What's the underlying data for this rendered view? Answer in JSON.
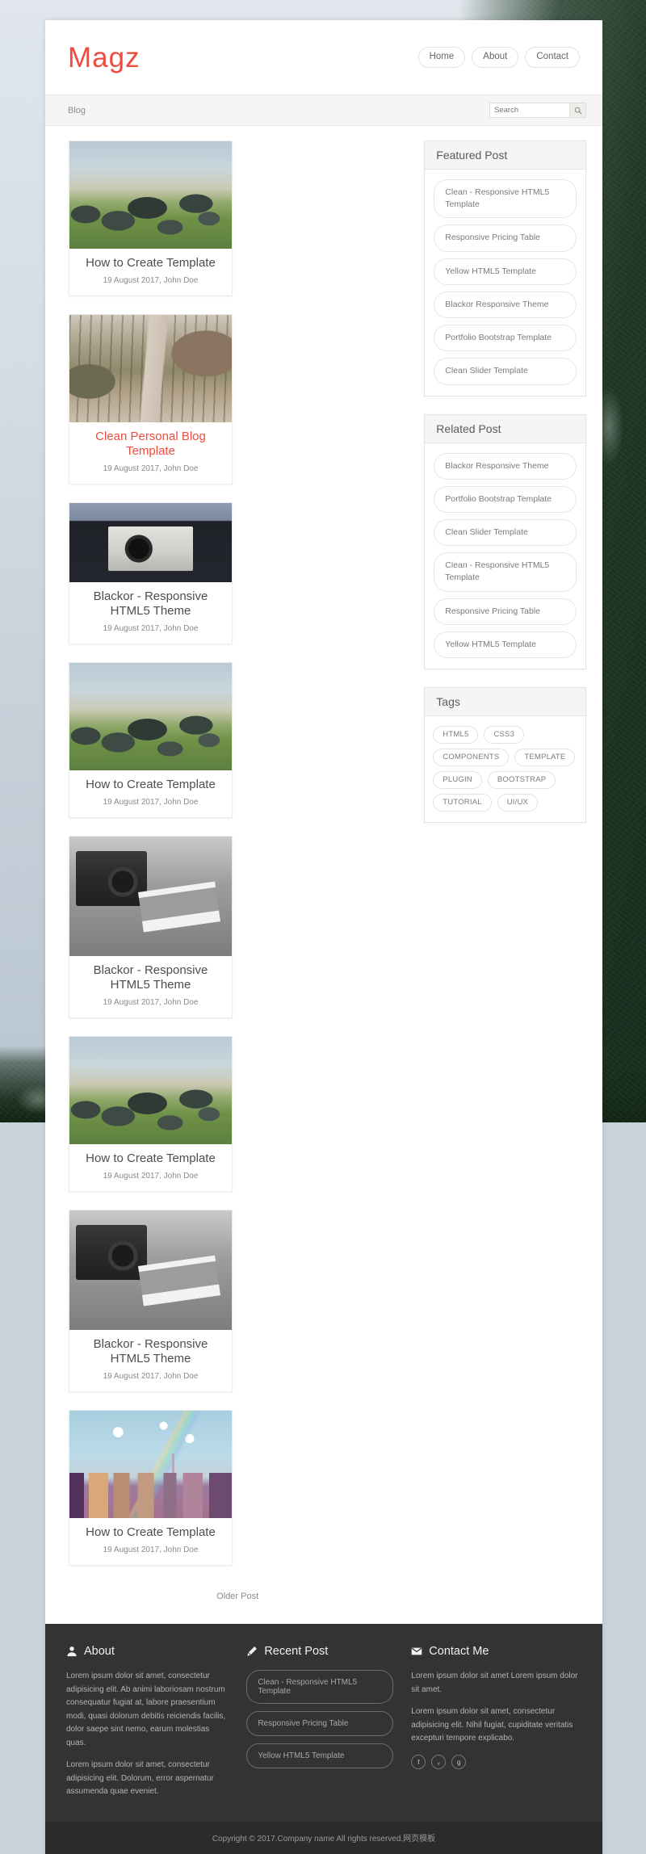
{
  "header": {
    "brand": "Magz",
    "nav": [
      {
        "label": "Home"
      },
      {
        "label": "About"
      },
      {
        "label": "Contact"
      }
    ]
  },
  "subbar": {
    "breadcrumb": "Blog",
    "search_placeholder": "Search",
    "search_value": "",
    "search_icon": "search-icon"
  },
  "posts": [
    {
      "title": "How to Create Template",
      "meta": "19 August 2017, John Doe",
      "thumb": "rocks-field-photo",
      "active": false
    },
    {
      "title": "Clean Personal Blog Template",
      "meta": "19 August 2017, John Doe",
      "thumb": "forest-road-photo",
      "active": true
    },
    {
      "title": "Blackor - Responsive HTML5 Theme",
      "meta": "19 August 2017, John Doe",
      "thumb": "vintage-camera-photo",
      "active": false
    },
    {
      "title": "How to Create Template",
      "meta": "19 August 2017, John Doe",
      "thumb": "rocks-field-photo",
      "active": false
    },
    {
      "title": "Blackor - Responsive HTML5 Theme",
      "meta": "19 August 2017, John Doe",
      "thumb": "bw-slr-camera-photo",
      "active": false
    },
    {
      "title": "How to Create Template",
      "meta": "19 August 2017, John Doe",
      "thumb": "rocks-field-photo",
      "active": false
    },
    {
      "title": "Blackor - Responsive HTML5 Theme",
      "meta": "19 August 2017, John Doe",
      "thumb": "bw-slr-camera-photo",
      "active": false
    },
    {
      "title": "How to Create Template",
      "meta": "19 August 2017, John Doe",
      "thumb": "city-rainbow-photo",
      "active": false
    }
  ],
  "pagination": {
    "older": "Older Post"
  },
  "sidebar": {
    "featured": {
      "title": "Featured Post",
      "items": [
        "Clean - Responsive HTML5 Template",
        "Responsive Pricing Table",
        "Yellow HTML5 Template",
        "Blackor Responsive Theme",
        "Portfolio Bootstrap Template",
        "Clean Slider Template"
      ]
    },
    "related": {
      "title": "Related Post",
      "items": [
        "Blackor Responsive Theme",
        "Portfolio Bootstrap Template",
        "Clean Slider Template",
        "Clean - Responsive HTML5 Template",
        "Responsive Pricing Table",
        "Yellow HTML5 Template"
      ]
    },
    "tags": {
      "title": "Tags",
      "items": [
        "HTML5",
        "CSS3",
        "COMPONENTS",
        "TEMPLATE",
        "PLUGIN",
        "BOOTSTRAP",
        "TUTORIAL",
        "UI/UX"
      ]
    }
  },
  "footer": {
    "about": {
      "title": "About",
      "icon": "user-icon",
      "paragraphs": [
        "Lorem ipsum dolor sit amet, consectetur adipisicing elit. Ab animi laboriosam nostrum consequatur fugiat at, labore praesentium modi, quasi dolorum debitis reiciendis facilis, dolor saepe sint nemo, earum molestias quas.",
        "Lorem ipsum dolor sit amet, consectetur adipisicing elit. Dolorum, error aspernatur assumenda quae eveniet."
      ]
    },
    "recent": {
      "title": "Recent Post",
      "icon": "pencil-icon",
      "items": [
        "Clean - Responsive HTML5 Template",
        "Responsive Pricing Table",
        "Yellow HTML5 Template"
      ]
    },
    "contact": {
      "title": "Contact Me",
      "icon": "envelope-icon",
      "paragraphs": [
        "Lorem ipsum dolor sit amet Lorem ipsum dolor sit amet.",
        "Lorem ipsum dolor sit amet, consectetur adipisicing elit. Nihil fugiat, cupiditate veritatis excepturi tempore explicabo."
      ],
      "socials": [
        {
          "name": "facebook-icon",
          "glyph": "f"
        },
        {
          "name": "twitter-icon",
          "glyph": "ᵥ"
        },
        {
          "name": "google-plus-icon",
          "glyph": "g"
        }
      ]
    },
    "copyright": "Copyright © 2017.Company name All rights reserved.网页模板"
  },
  "colors": {
    "accent": "#ef4b3f",
    "footer_bg": "#333333",
    "copyright_bg": "#2b2b2b",
    "page_bg": "#ffffff"
  }
}
